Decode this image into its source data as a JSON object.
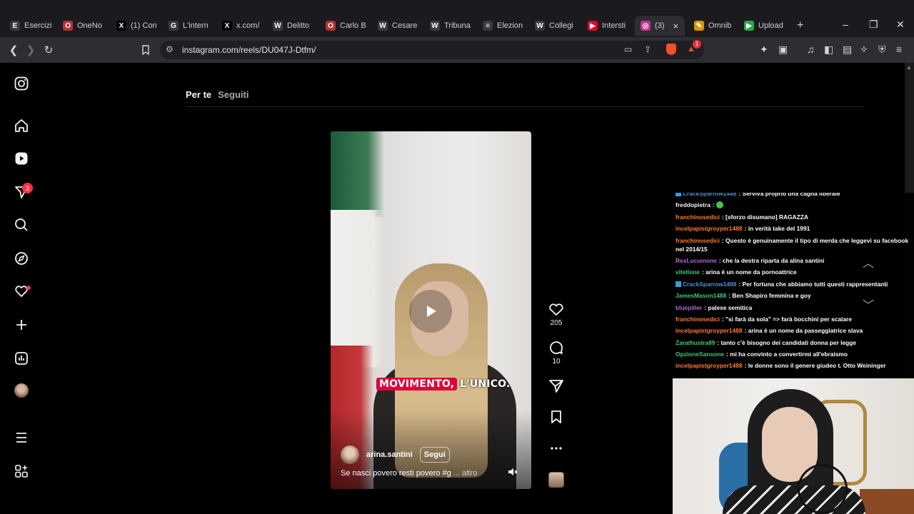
{
  "browser": {
    "tabs": [
      {
        "label": "Esercizi",
        "favicon": "E",
        "color": "#3a3a3a"
      },
      {
        "label": "OneNo",
        "favicon": "O",
        "color": "#b0333a"
      },
      {
        "label": "(1) Con",
        "favicon": "X",
        "color": "#000000"
      },
      {
        "label": "L'intern",
        "favicon": "G",
        "color": "#3a3a3a"
      },
      {
        "label": "x.com/",
        "favicon": "X",
        "color": "#000000"
      },
      {
        "label": "Delitto",
        "favicon": "W",
        "color": "#3a3a3a"
      },
      {
        "label": "Carlo B",
        "favicon": "O",
        "color": "#b0333a"
      },
      {
        "label": "Cesare",
        "favicon": "W",
        "color": "#3a3a3a"
      },
      {
        "label": "Tribuna",
        "favicon": "W",
        "color": "#3a3a3a"
      },
      {
        "label": "Elezion",
        "favicon": "≡",
        "color": "#3a3a3a"
      },
      {
        "label": "Collegi",
        "favicon": "W",
        "color": "#3a3a3a"
      },
      {
        "label": "Intersti",
        "favicon": "▶",
        "color": "#e0002b"
      },
      {
        "label": "(3)",
        "favicon": "◎",
        "color": "#c1358a"
      },
      {
        "label": "Omnib",
        "favicon": "✎",
        "color": "#d39b00"
      },
      {
        "label": "Upload",
        "favicon": "▶",
        "color": "#2aa54a"
      }
    ],
    "new_tab": "+",
    "url": "instagram.com/reels/DU047J-Dtfm/",
    "brave_badge": "1"
  },
  "instagram": {
    "feed_tabs": {
      "for_you": "Per te",
      "following": "Seguiti"
    },
    "notification_badge": "3",
    "reel": {
      "caption_highlight": "MOVIMENTO,",
      "caption_plain": "L'UNICO.",
      "author": "arina.santini",
      "follow_label": "Segui",
      "description": "Se nasci povero resti povero #g",
      "more_label": "... altro"
    },
    "actions": {
      "likes": "205",
      "comments": "10"
    }
  },
  "chat": {
    "messages": [
      {
        "user": "CrackSparrow1488",
        "color": "#5b8bd8",
        "twitter": true,
        "text": "Serviva proprio una cagna liberale"
      },
      {
        "user": "freddopietra",
        "color": "#f0f0f0",
        "twitter": false,
        "text": ""
      },
      {
        "user": "franchinosedici",
        "color": "#ff7b2a",
        "twitter": false,
        "text": "[sforzo disumano] RAGAZZA"
      },
      {
        "user": "incelpapistgroyper1488",
        "color": "#ff7b2a",
        "twitter": false,
        "text": "in verità take del 1991"
      },
      {
        "user": "franchinosedici",
        "color": "#ff7b2a",
        "twitter": false,
        "text": "Questo è genuinamente il tipo di merda che leggevi su facebook nel 2014/15"
      },
      {
        "user": "RexLucumone",
        "color": "#b06bd8",
        "twitter": false,
        "text": "che la destra riparta da alina santini"
      },
      {
        "user": "vitellone",
        "color": "#3fc87a",
        "twitter": false,
        "text": "arina è un nome da pornoattrice"
      },
      {
        "user": "CrackSparrow1488",
        "color": "#5b8bd8",
        "twitter": true,
        "text": "Per fortuna che abbiamo tutti questi rappresentanti"
      },
      {
        "user": "JamesMason1488",
        "color": "#3fc87a",
        "twitter": false,
        "text": "Ben Shapiro femmina e goy"
      },
      {
        "user": "bluepiller",
        "color": "#b06bd8",
        "twitter": false,
        "text": "palese semitica"
      },
      {
        "user": "franchinosedici",
        "color": "#ff7b2a",
        "twitter": false,
        "text": "\"si farà da sola\" => farà bocchini per scalare"
      },
      {
        "user": "incelpapistgroyper1488",
        "color": "#ff7b2a",
        "twitter": false,
        "text": "arina è un nome da passeggiatrice slava"
      },
      {
        "user": "Zarathustra89",
        "color": "#3fc87a",
        "twitter": false,
        "text": "tanto c'è bisogno dei candidati donna per legge"
      },
      {
        "user": "OpzioneSansone",
        "color": "#3fc87a",
        "twitter": false,
        "text": "mi ha convinto a convertirmi all'ebraismo"
      },
      {
        "user": "incelpapistgroyper1488",
        "color": "#ff7b2a",
        "twitter": false,
        "text": "le donne sono il genere giudeo t. Otto Weininger"
      }
    ]
  },
  "colors": {
    "accent_red": "#ff3040",
    "caption_pink": "#e0003a"
  }
}
